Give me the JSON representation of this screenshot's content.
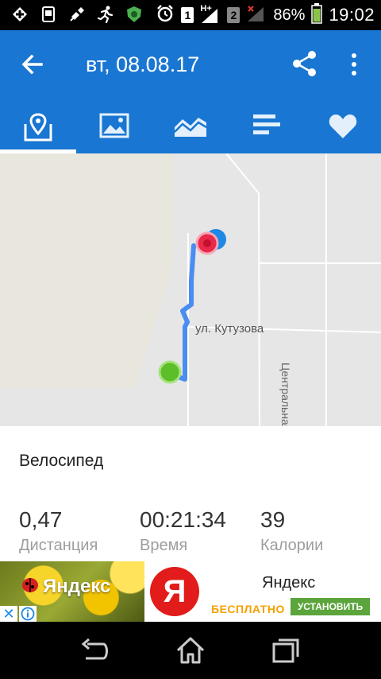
{
  "status_bar": {
    "sim1": "1",
    "sim2": "2",
    "network": "H+",
    "battery_percent": "86%",
    "time": "19:02"
  },
  "app_bar": {
    "title": "вт, 08.08.17",
    "tabs": [
      {
        "icon": "map-icon",
        "active": true
      },
      {
        "icon": "image-icon",
        "active": false
      },
      {
        "icon": "chart-icon",
        "active": false
      },
      {
        "icon": "bars-icon",
        "active": false
      },
      {
        "icon": "heart-icon",
        "active": false
      }
    ]
  },
  "map": {
    "street_horizontal": "ул. Кутузова",
    "street_vertical": "Центральная ул."
  },
  "workout": {
    "activity": "Велосипед",
    "stats": [
      {
        "value": "0,47",
        "label": "Дистанция"
      },
      {
        "value": "00:21:34",
        "label": "Время"
      },
      {
        "value": "39",
        "label": "Калории"
      }
    ]
  },
  "ad": {
    "image_text": "Яндекс",
    "logo_letter": "Я",
    "title": "Яндекс",
    "free_label": "БЕСПЛАТНО",
    "install_label": "УСТАНОВИТЬ",
    "close_glyph": "✕"
  },
  "colors": {
    "primary": "#1976d2",
    "route": "#4a8df0",
    "start_marker": "#5cbf2a",
    "end_marker": "#e8294a",
    "position_marker": "#1e88e5"
  }
}
